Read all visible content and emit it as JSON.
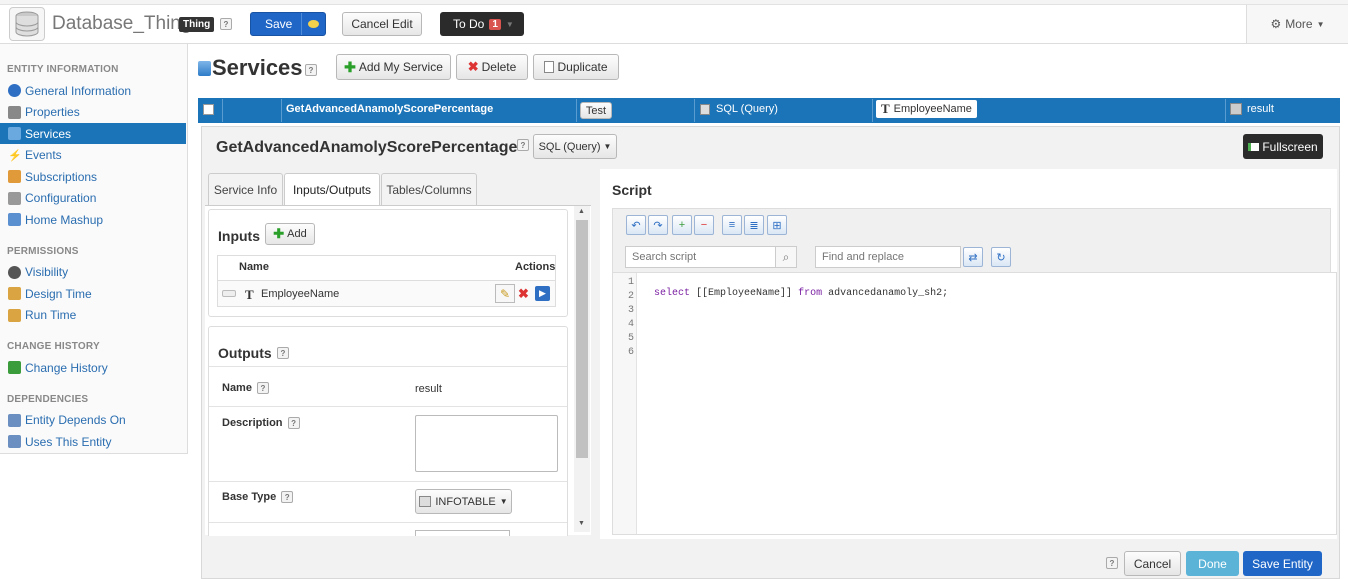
{
  "header": {
    "entity_name": "Database_Thing",
    "entity_badge": "Thing",
    "save_label": "Save",
    "cancel_edit_label": "Cancel Edit",
    "todo_label": "To Do",
    "todo_count": "1",
    "more_label": "More"
  },
  "sidebar": {
    "sections": [
      {
        "title": "ENTITY INFORMATION",
        "items": [
          {
            "label": "General Information",
            "icon": "info-icon"
          },
          {
            "label": "Properties",
            "icon": "properties-icon"
          },
          {
            "label": "Services",
            "icon": "services-icon",
            "active": true
          },
          {
            "label": "Events",
            "icon": "lightning-icon"
          },
          {
            "label": "Subscriptions",
            "icon": "subscriptions-icon"
          },
          {
            "label": "Configuration",
            "icon": "gear-icon"
          },
          {
            "label": "Home Mashup",
            "icon": "mashup-icon"
          }
        ]
      },
      {
        "title": "PERMISSIONS",
        "items": [
          {
            "label": "Visibility",
            "icon": "eye-icon"
          },
          {
            "label": "Design Time",
            "icon": "user-icon"
          },
          {
            "label": "Run Time",
            "icon": "user-icon"
          }
        ]
      },
      {
        "title": "CHANGE HISTORY",
        "items": [
          {
            "label": "Change History",
            "icon": "history-icon"
          }
        ]
      },
      {
        "title": "DEPENDENCIES",
        "items": [
          {
            "label": "Entity Depends On",
            "icon": "dependency-icon"
          },
          {
            "label": "Uses This Entity",
            "icon": "dependency-icon"
          }
        ]
      }
    ]
  },
  "services": {
    "title": "Services",
    "add_label": "Add My Service",
    "delete_label": "Delete",
    "duplicate_label": "Duplicate",
    "row": {
      "name": "GetAdvancedAnamolyScorePercentage",
      "test_label": "Test",
      "type": "SQL (Query)",
      "input": "EmployeeName",
      "output": "result"
    }
  },
  "editor": {
    "service_name": "GetAdvancedAnamolyScorePercentage",
    "type_select": "SQL (Query)",
    "fullscreen_label": "Fullscreen",
    "tabs": [
      "Service Info",
      "Inputs/Outputs",
      "Tables/Columns"
    ],
    "inputs": {
      "title": "Inputs",
      "add_label": "Add",
      "col_name": "Name",
      "col_actions": "Actions",
      "rows": [
        {
          "name": "EmployeeName"
        }
      ]
    },
    "outputs": {
      "title": "Outputs",
      "name_label": "Name",
      "name_value": "result",
      "description_label": "Description",
      "description_value": "",
      "base_type_label": "Base Type",
      "base_type_value": "INFOTABLE"
    },
    "script": {
      "title": "Script",
      "search_placeholder": "Search script",
      "replace_placeholder": "Find and replace",
      "line_numbers": [
        "1",
        "2",
        "3",
        "4",
        "5",
        "6"
      ],
      "code": {
        "kw1": "select",
        "p1": " [[EmployeeName]] ",
        "kw2": "from",
        "p2": " advancedanamoly_sh2;"
      }
    }
  },
  "footer": {
    "cancel_label": "Cancel",
    "done_label": "Done",
    "save_entity_label": "Save Entity"
  },
  "colors": {
    "accent": "#1b74b8",
    "sidebar_active": "#1b74b8",
    "save_button": "#1f66c7",
    "done_button": "#5bb4d8",
    "dark_button": "#2b2b2b",
    "todo_badge": "#d9534f"
  }
}
